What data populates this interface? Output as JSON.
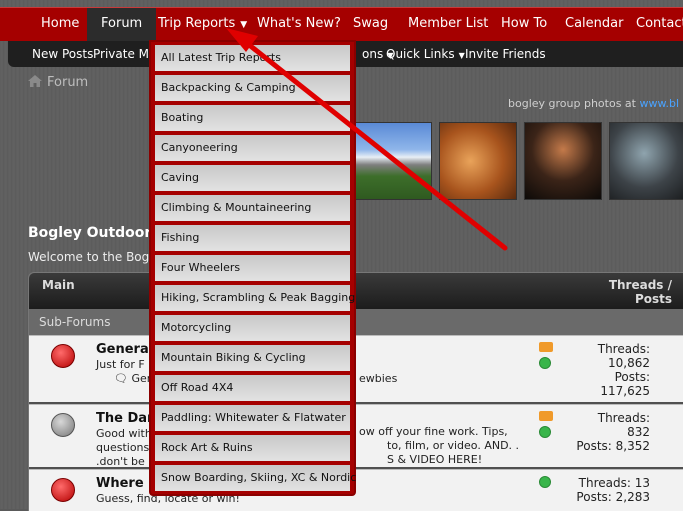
{
  "topnav": {
    "items": [
      "Home",
      "Forum",
      "Trip Reports",
      "What's New?",
      "Swag",
      "Member List",
      "How To",
      "Calendar",
      "Contact"
    ]
  },
  "subnav": {
    "items": [
      "New Posts",
      "Private Me",
      "ons",
      "Quick Links",
      "Invite Friends"
    ]
  },
  "breadcrumb": "Forum",
  "photo_credit": {
    "text": "bogley group photos at",
    "link": "www.bl"
  },
  "title": "Bogley Outdoor",
  "welcome": "Welcome to the Bogle",
  "table": {
    "col_main": "Main",
    "col_threads": "Threads /",
    "col_posts": "Posts",
    "subforums": "Sub-Forums",
    "rows": [
      {
        "title": "Genera",
        "desc": "Just for F",
        "desc2": "Gen",
        "right_desc": "ewbies",
        "threads": "Threads:",
        "threads_val": "10,862",
        "posts": "Posts:",
        "posts_val": "117,625"
      },
      {
        "title": "The Dar",
        "desc": "Good with",
        "desc2": "questions",
        "desc3": ".don't be",
        "right_desc": "ow off your fine work. Tips,",
        "right_desc2": "to, film, or video. AND. .",
        "right_desc3": "S & VIDEO HERE!",
        "threads": "Threads:",
        "threads_val": "832",
        "posts": "Posts: 8,352"
      },
      {
        "title": "Where i",
        "desc": "Guess, find, locate or win!",
        "threads": "Threads: 13",
        "posts": "Posts: 2,283"
      }
    ]
  },
  "dropdown": {
    "items": [
      "All Latest Trip Reports",
      "Backpacking & Camping",
      "Boating",
      "Canyoneering",
      "Caving",
      "Climbing & Mountaineering",
      "Fishing",
      "Four Wheelers",
      "Hiking, Scrambling & Peak Bagging",
      "Motorcycling",
      "Mountain Biking & Cycling",
      "Off Road 4X4",
      "Paddling: Whitewater & Flatwater",
      "Rock Art & Ruins",
      "Snow Boarding, Skiing, XC & Nordic"
    ]
  },
  "colors": {
    "accent": "#a50000",
    "arrow": "#e00000"
  }
}
